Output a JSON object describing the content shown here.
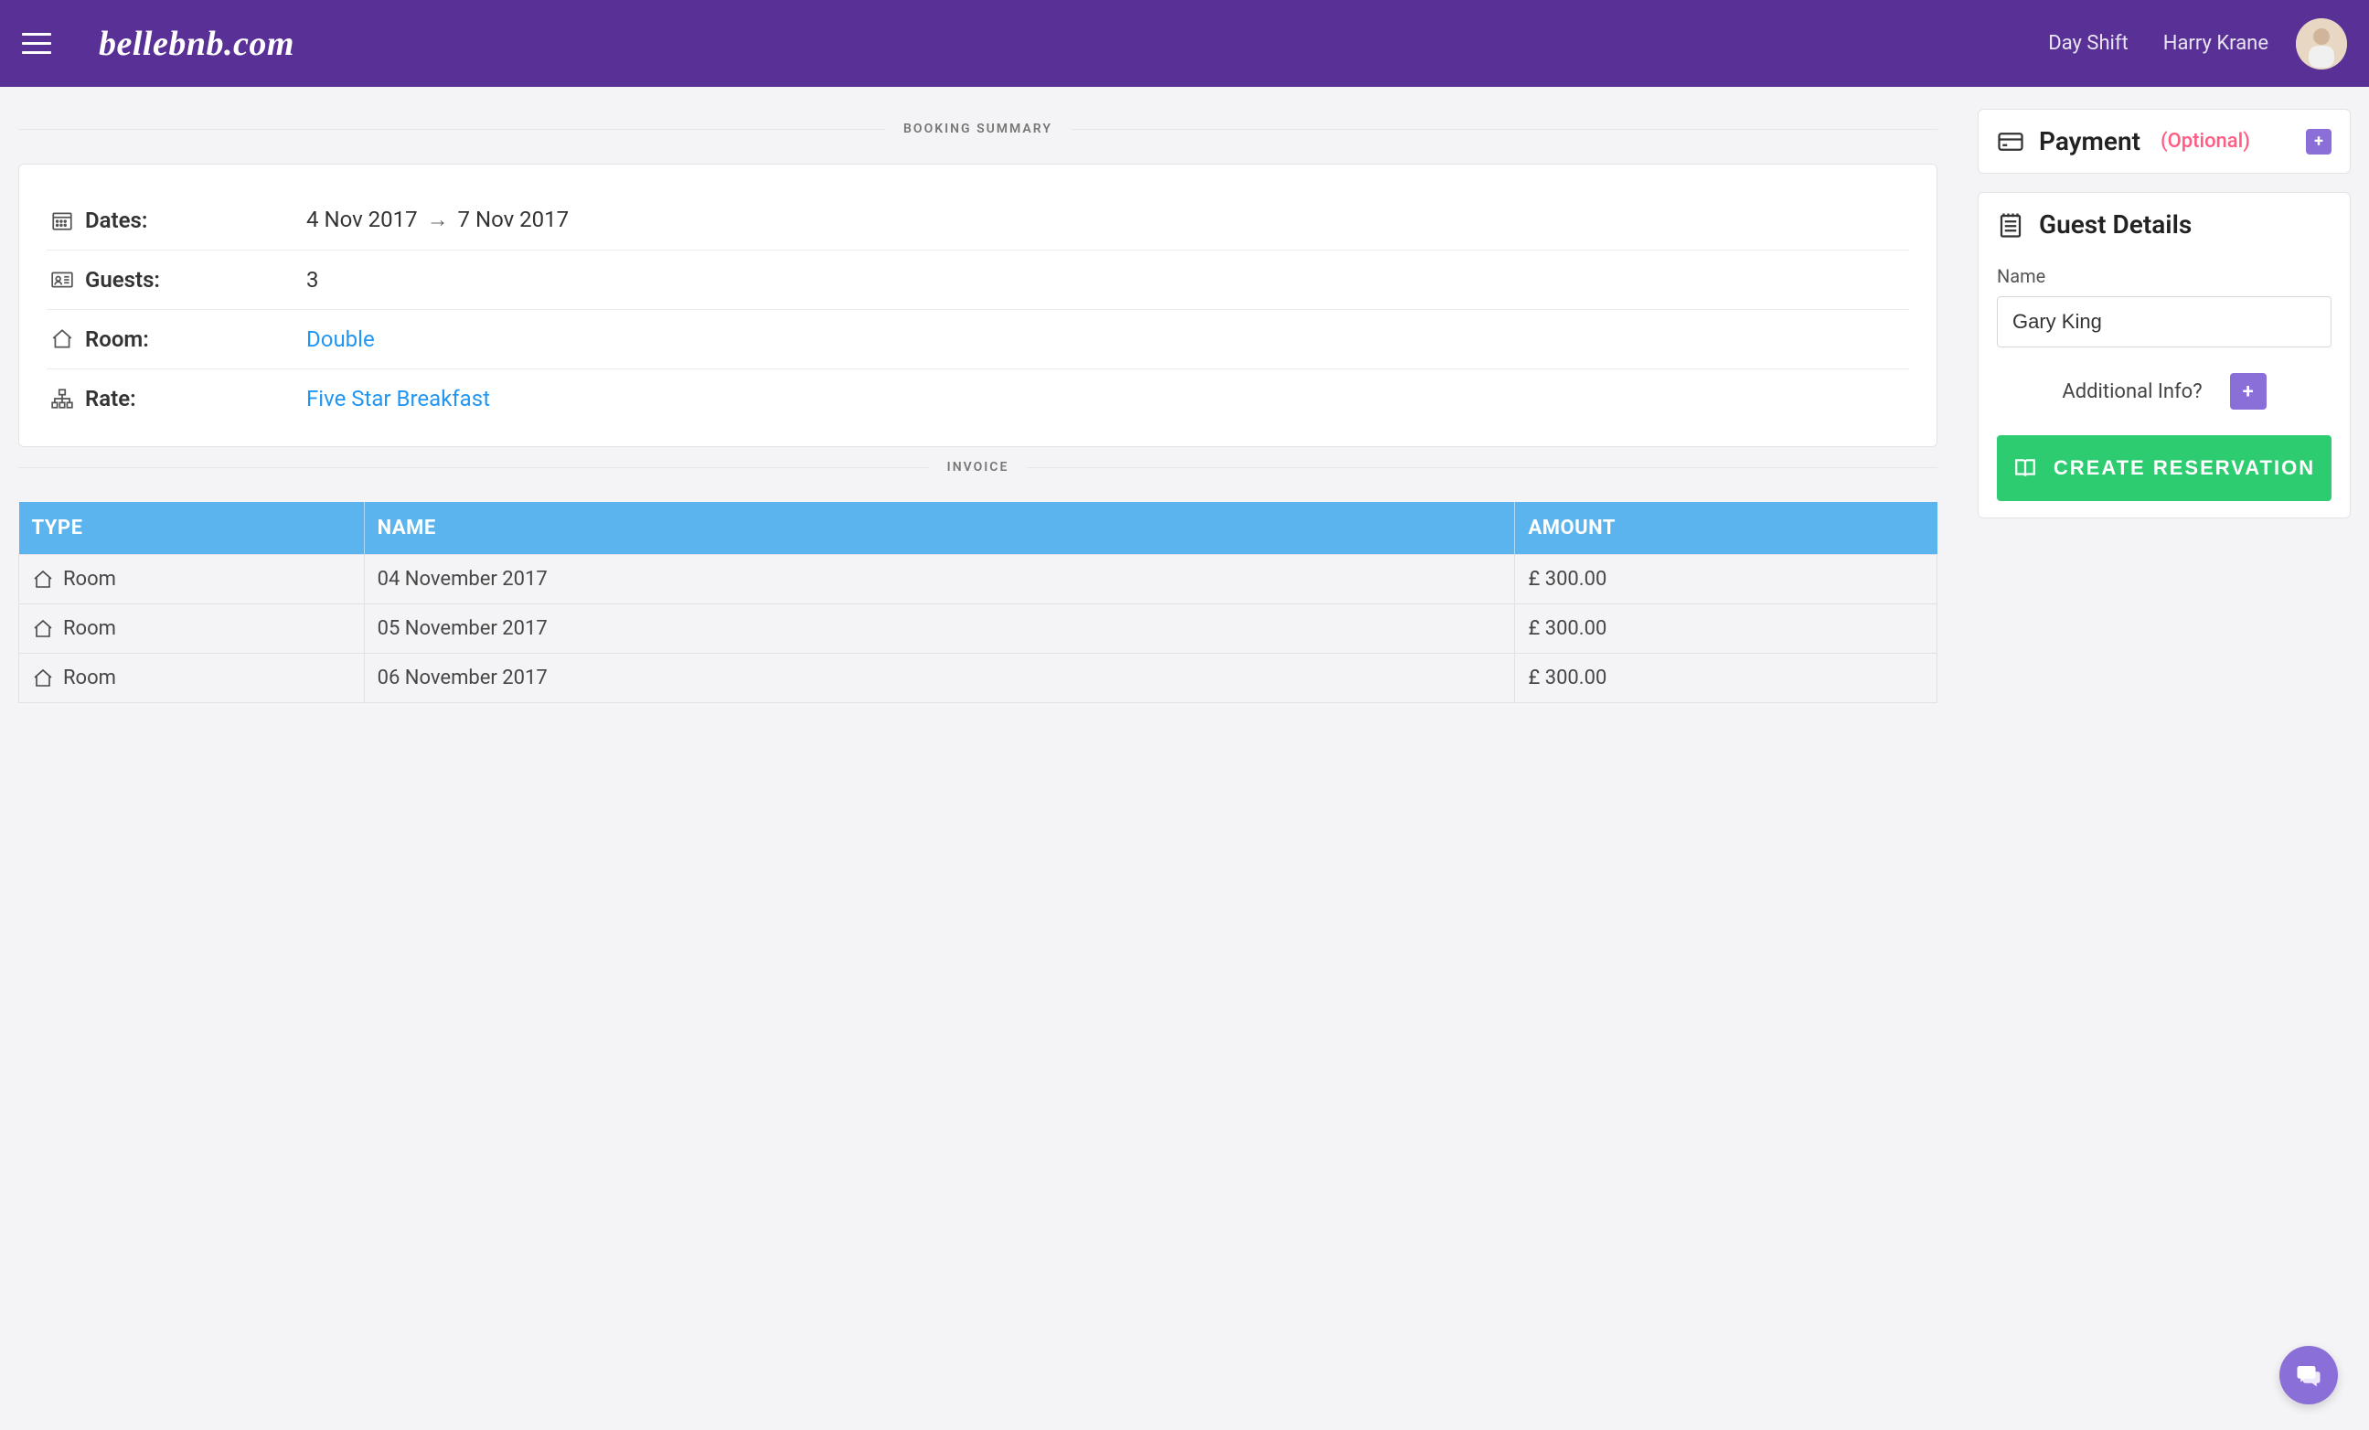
{
  "header": {
    "logo": "bellebnb.com",
    "shift_label": "Day Shift",
    "username": "Harry Krane"
  },
  "sections": {
    "booking_summary": "BOOKING SUMMARY",
    "invoice": "INVOICE"
  },
  "summary": {
    "dates_label": "Dates:",
    "date_from": "4 Nov 2017",
    "date_to": "7 Nov 2017",
    "guests_label": "Guests:",
    "guests_value": "3",
    "room_label": "Room:",
    "room_value": "Double",
    "rate_label": "Rate:",
    "rate_value": "Five Star Breakfast"
  },
  "invoice": {
    "columns": {
      "type": "TYPE",
      "name": "NAME",
      "amount": "AMOUNT"
    },
    "rows": [
      {
        "type": "Room",
        "name": "04 November 2017",
        "amount": "£ 300.00"
      },
      {
        "type": "Room",
        "name": "05 November 2017",
        "amount": "£ 300.00"
      },
      {
        "type": "Room",
        "name": "06 November 2017",
        "amount": "£ 300.00"
      }
    ]
  },
  "payment": {
    "title": "Payment",
    "subtitle": "(Optional)"
  },
  "guest": {
    "title": "Guest Details",
    "name_label": "Name",
    "name_value": "Gary King",
    "additional_label": "Additional Info?",
    "create_label": "CREATE RESERVATION"
  }
}
